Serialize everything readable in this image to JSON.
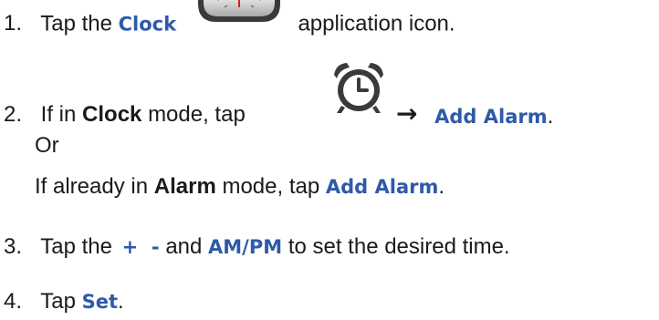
{
  "steps": {
    "s1": {
      "num": "1.",
      "pre": "Tap the",
      "term": "Clock",
      "post": "application icon.",
      "icon": "clock-app-icon"
    },
    "s2": {
      "num": "2.",
      "a_pre": "If in",
      "a_mode": "Clock",
      "a_mid": "mode, tap",
      "a_icon": "alarm-clock-icon",
      "a_arrow": "→",
      "a_term": "Add Alarm",
      "a_end": ".",
      "or": "Or",
      "b_pre": "If already in",
      "b_mode": "Alarm",
      "b_mid": "mode, tap",
      "b_term": "Add Alarm",
      "b_end": "."
    },
    "s3": {
      "num": "3.",
      "pre": "Tap the",
      "plus": "+",
      "minus": "-",
      "and": "and",
      "ampm": "AM/PM",
      "post": "to set the desired time."
    },
    "s4": {
      "num": "4.",
      "pre": "Tap",
      "term": "Set",
      "end": "."
    }
  },
  "colors": {
    "ui_term": "#2e5aa8",
    "arrow": "#1a1a1a",
    "text": "#1a1a1a"
  }
}
